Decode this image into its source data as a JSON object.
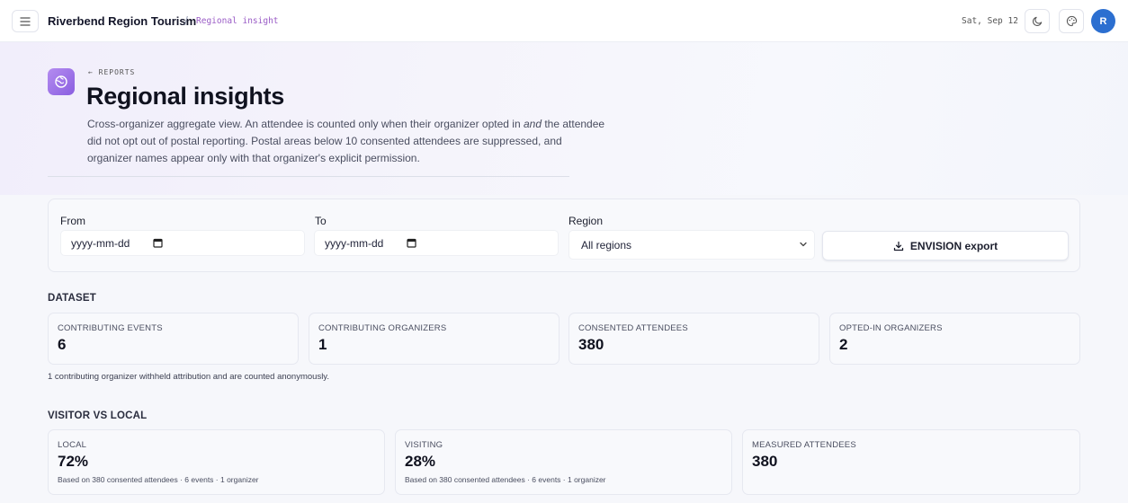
{
  "topbar": {
    "brand": "Riverbend Region Tourism",
    "separator": "/",
    "current": "Regional insight",
    "date": "Sat, Sep 12",
    "avatar_initial": "R"
  },
  "header": {
    "back_label": "← REPORTS",
    "title": "Regional insights",
    "description_part1": "Cross-organizer aggregate view. An attendee is counted only when their organizer opted in ",
    "description_emphasis": "and",
    "description_part2": " the attendee did not opt out of postal reporting. Postal areas below 10 consented attendees are suppressed, and organizer names appear only with that organizer's explicit permission."
  },
  "filters": {
    "from_label": "From",
    "from_placeholder": "yyyy-mm-dd",
    "to_label": "To",
    "to_placeholder": "yyyy-mm-dd",
    "region_label": "Region",
    "region_value": "All regions",
    "export_label": "ENVISION export"
  },
  "dataset": {
    "title": "DATASET",
    "cards": [
      {
        "label": "CONTRIBUTING EVENTS",
        "value": "6"
      },
      {
        "label": "CONTRIBUTING ORGANIZERS",
        "value": "1"
      },
      {
        "label": "CONSENTED ATTENDEES",
        "value": "380"
      },
      {
        "label": "OPTED-IN ORGANIZERS",
        "value": "2"
      }
    ],
    "note": "1 contributing organizer withheld attribution and are counted anonymously."
  },
  "visitor": {
    "title": "VISITOR VS LOCAL",
    "cards": [
      {
        "label": "LOCAL",
        "value": "72%",
        "sub": "Based on 380 consented attendees · 6 events · 1 organizer"
      },
      {
        "label": "VISITING",
        "value": "28%",
        "sub": "Based on 380 consented attendees · 6 events · 1 organizer"
      },
      {
        "label": "MEASURED ATTENDEES",
        "value": "380"
      }
    ]
  },
  "icons": {
    "menu": "menu-icon",
    "theme": "moon-icon",
    "palette": "palette-icon",
    "report": "globe-icon",
    "calendar": "calendar-icon",
    "chevron": "chevron-down-icon",
    "download": "download-icon"
  },
  "colors": {
    "accent": "#9a5cc6",
    "avatar": "#2c6fd0"
  }
}
